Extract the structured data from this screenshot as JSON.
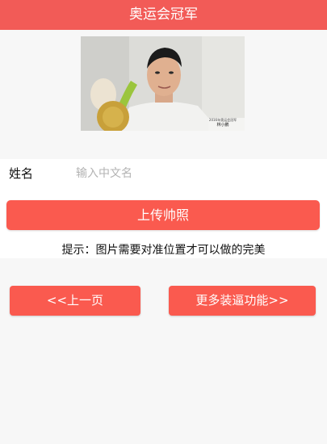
{
  "header": {
    "title": "奥运会冠军"
  },
  "photo": {
    "caption_line1": "2016年奥运会冠军",
    "caption_name": "林小鹏"
  },
  "form": {
    "name_label": "姓名",
    "name_placeholder": "输入中文名",
    "name_value": ""
  },
  "upload": {
    "button_label": "上传帅照",
    "tip": "提示：图片需要对准位置才可以做的完美"
  },
  "nav": {
    "prev_label": "<<上一页",
    "more_label": "更多装逼功能>>"
  },
  "colors": {
    "header_bg": "#f25b57",
    "button_bg": "#fa5a4f",
    "page_bg": "#f7f7f7"
  }
}
